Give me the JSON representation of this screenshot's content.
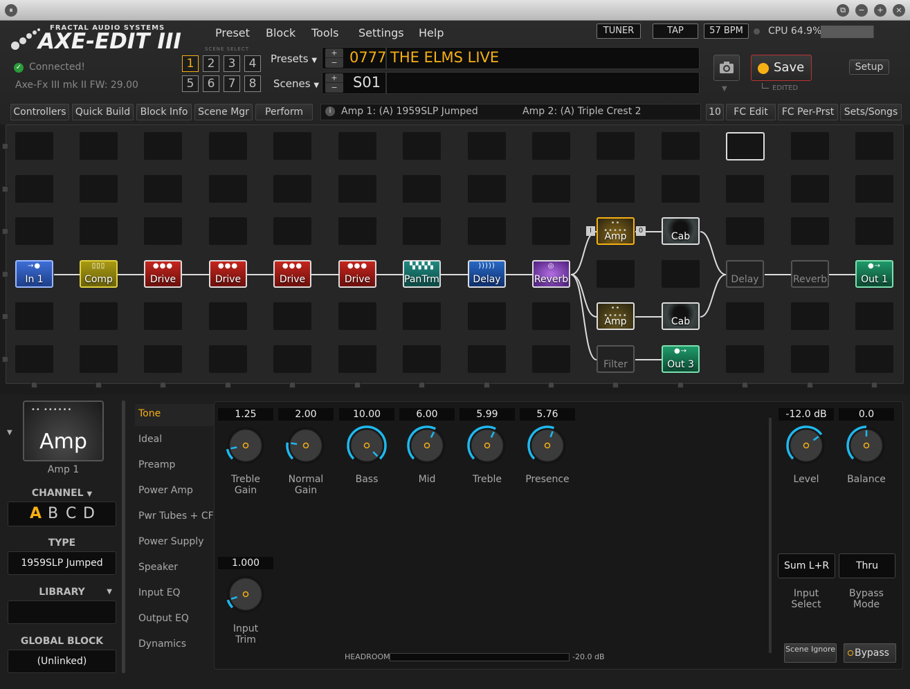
{
  "app": {
    "brand_small": "FRACTAL AUDIO SYSTEMS",
    "brand_big": "AXE-EDIT III"
  },
  "menu": [
    "Preset",
    "Block",
    "Tools",
    "Settings",
    "Help"
  ],
  "topbar": {
    "tuner": "TUNER",
    "tap": "TAP",
    "bpm": "57 BPM",
    "cpu": "CPU 64.9%",
    "cpu_fraction": 0.649
  },
  "status": {
    "connected": "Connected!",
    "firmware": "Axe-Fx III mk II FW: 29.00"
  },
  "scene_select": {
    "label": "SCENE SELECT",
    "numbers": [
      "1",
      "2",
      "3",
      "4",
      "5",
      "6",
      "7",
      "8"
    ],
    "active": "1"
  },
  "preset": {
    "label": "Presets",
    "number": "0777",
    "name": "THE ELMS LIVE"
  },
  "scene": {
    "label": "Scenes",
    "name": "S01"
  },
  "save": {
    "label": "Save",
    "edited": "EDITED"
  },
  "setup_label": "Setup",
  "tabs_left": [
    "Controllers",
    "Quick Build",
    "Block Info",
    "Scene Mgr",
    "Perform"
  ],
  "info": {
    "amp1": "Amp 1: (A) 1959SLP Jumped",
    "amp2": "Amp 2: (A) Triple Crest 2"
  },
  "tabs_right": [
    "10",
    "FC Edit",
    "FC Per-Prst",
    "Sets/Songs"
  ],
  "grid_blocks": {
    "in1": "In 1",
    "comp": "Comp",
    "drive1": "Drive",
    "drive2": "Drive",
    "drive3": "Drive",
    "drive4": "Drive",
    "pantrm": "PanTrm",
    "delay": "Delay",
    "reverb": "Reverb",
    "amp_top": "Amp",
    "cab_top": "Cab",
    "amp_bot": "Amp",
    "cab_bot": "Cab",
    "filter": "Filter",
    "out3": "Out 3",
    "delay_ghost": "Delay",
    "reverb_ghost": "Reverb",
    "out1": "Out 1",
    "amp_in_badge": "I",
    "amp_out_badge": "0"
  },
  "block_editor": {
    "block_name": "Amp",
    "block_instance": "Amp 1",
    "channel_label": "CHANNEL",
    "channels": [
      "A",
      "B",
      "C",
      "D"
    ],
    "active_channel": "A",
    "type_label": "TYPE",
    "type_value": "1959SLP Jumped",
    "library_label": "LIBRARY",
    "library_value": "",
    "global_label": "GLOBAL BLOCK",
    "global_value": "(Unlinked)"
  },
  "pages": [
    "Tone",
    "Ideal",
    "Preamp",
    "Power Amp",
    "Pwr Tubes + CF",
    "Power Supply",
    "Speaker",
    "Input EQ",
    "Output EQ",
    "Dynamics"
  ],
  "active_page": "Tone",
  "knobs": [
    {
      "value": "1.25",
      "label1": "Treble",
      "label2": "Gain",
      "frac": 0.125
    },
    {
      "value": "2.00",
      "label1": "Normal",
      "label2": "Gain",
      "frac": 0.2
    },
    {
      "value": "10.00",
      "label1": "Bass",
      "label2": "",
      "frac": 1.0
    },
    {
      "value": "6.00",
      "label1": "Mid",
      "label2": "",
      "frac": 0.6
    },
    {
      "value": "5.99",
      "label1": "Treble",
      "label2": "",
      "frac": 0.599
    },
    {
      "value": "5.76",
      "label1": "Presence",
      "label2": "",
      "frac": 0.576
    }
  ],
  "input_trim": {
    "value": "1.000",
    "label1": "Input",
    "label2": "Trim",
    "frac": 0.1
  },
  "level": {
    "value": "-12.0 dB",
    "label": "Level",
    "frac": 0.7
  },
  "balance": {
    "value": "0.0",
    "label": "Balance",
    "frac": 0.5
  },
  "input_select": {
    "value": "Sum L+R",
    "label1": "Input",
    "label2": "Select"
  },
  "bypass_mode": {
    "value": "Thru",
    "label1": "Bypass",
    "label2": "Mode"
  },
  "headroom": {
    "label": "HEADROOM",
    "value": "-20.0 dB"
  },
  "scene_ignore": "Scene Ignore",
  "bypass": "Bypass",
  "colors": {
    "accent": "#f7b014",
    "knob_arc": "#1fb8ee"
  }
}
